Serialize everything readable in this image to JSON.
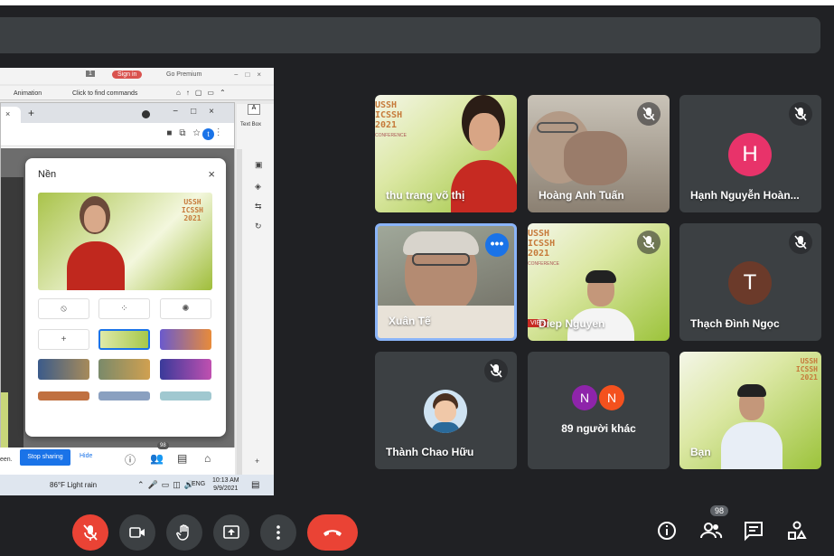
{
  "shared_screen": {
    "ppt": {
      "page_num": "1",
      "sign_in": "Sign in",
      "go_premium": "Go Premium",
      "animation_tab": "Animation",
      "find_commands": "Click to find commands",
      "text_box": "Text Box"
    },
    "background_dialog": {
      "title": "Nền",
      "close": "×",
      "preview_text": "USSH\nICSSH\n2021"
    },
    "share_bar": {
      "prefix_text": "een.",
      "stop_label": "Stop sharing",
      "hide_label": "Hide",
      "participant_count": "98"
    },
    "taskbar": {
      "weather": "86°F  Light rain",
      "lang": "ENG",
      "time": "10:13 AM",
      "date": "9/9/2021"
    }
  },
  "participants": [
    {
      "name": "thu trang võ thị",
      "muted": false
    },
    {
      "name": "Hoàng Anh Tuấn",
      "muted": true
    },
    {
      "name": "Hạnh Nguyễn Hoàn...",
      "muted": true,
      "initial": "H",
      "avatar_color": "#e8336a"
    },
    {
      "name": "Xuân Tế",
      "muted": false,
      "selected": true
    },
    {
      "name": "Diep Nguyen",
      "muted": true
    },
    {
      "name": "Thạch Đình Ngọc",
      "muted": true,
      "initial": "T",
      "avatar_color": "#6b3a2a"
    },
    {
      "name": "Thành Chao Hữu",
      "muted": true
    },
    {
      "name": "89 người khác",
      "initials": [
        "N",
        "N"
      ],
      "initial_colors": [
        "#8e24aa",
        "#f4511e"
      ]
    },
    {
      "name": "Bạn",
      "muted": false
    }
  ],
  "ussh_text": "USSH\nICSSH\n2021",
  "conference_label": "CONFERENCE",
  "vien_label": "VIỆN",
  "controls": {
    "participant_count": "98"
  },
  "colors": {
    "end_call": "#ea4335",
    "accent": "#1a73e8",
    "tile_bg": "#3c4043",
    "page_bg": "#202124"
  }
}
